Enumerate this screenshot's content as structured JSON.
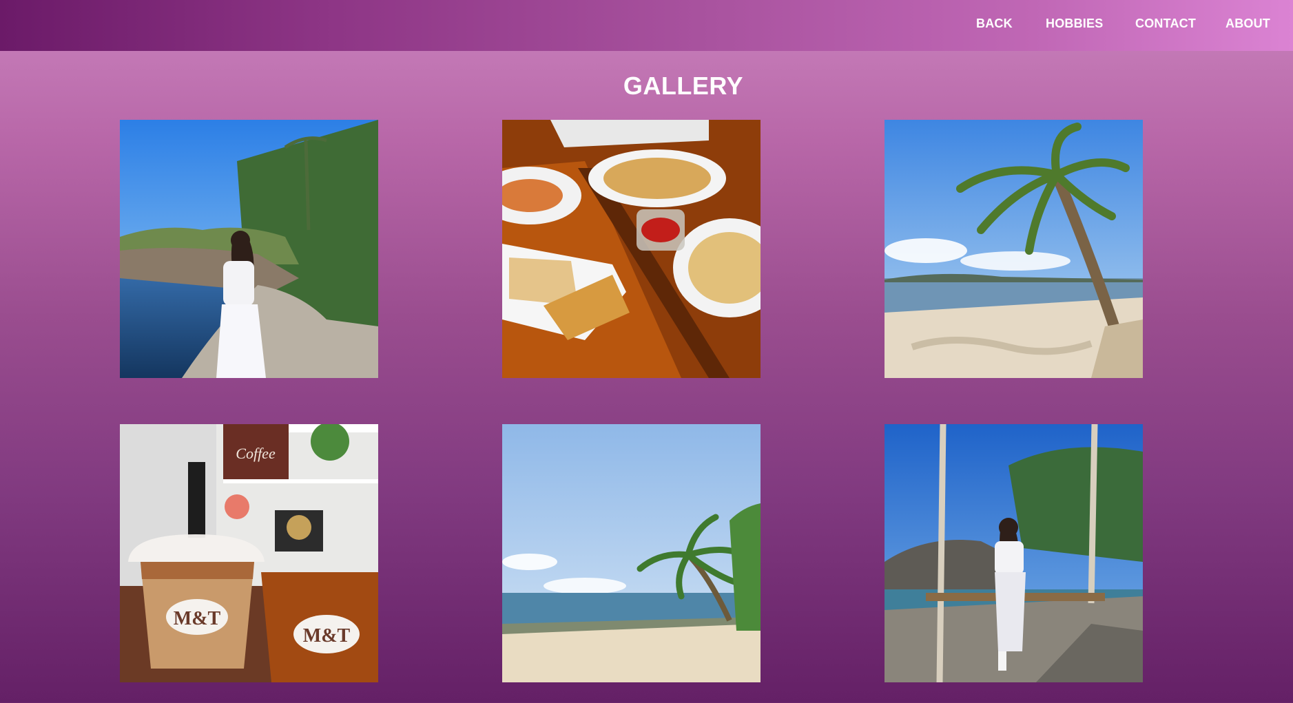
{
  "nav": {
    "back": "BACK",
    "hobbies": "HOBBIES",
    "contact": "CONTACT",
    "about": "ABOUT"
  },
  "page": {
    "title": "GALLERY"
  },
  "photos": {
    "1": {
      "icon": "beach-rocks-portrait"
    },
    "2": {
      "icon": "food-table"
    },
    "3": {
      "icon": "palm-beach"
    },
    "4": {
      "icon": "iced-coffee-drinks",
      "logo_text": "M&T",
      "sign_text": "Coffee"
    },
    "5": {
      "icon": "beach-shore"
    },
    "6": {
      "icon": "rope-swing-portrait"
    }
  },
  "colors": {
    "nav_start": "#6b1a68",
    "nav_end": "#db83d3",
    "page_top": "#c982bd",
    "page_bottom": "#642066",
    "text": "#ffffff"
  }
}
